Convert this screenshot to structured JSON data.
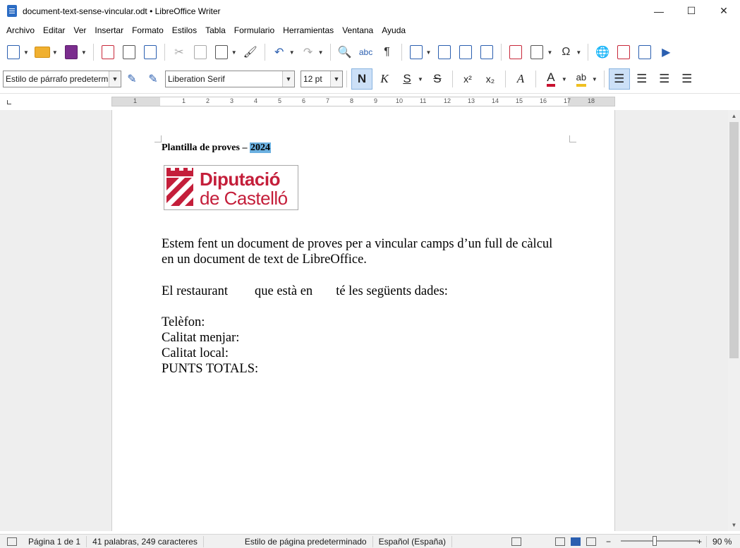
{
  "window": {
    "title": "document-text-sense-vincular.odt • LibreOffice Writer",
    "minimize": "—",
    "maximize": "☐",
    "close": "✕"
  },
  "menu": [
    "Archivo",
    "Editar",
    "Ver",
    "Insertar",
    "Formato",
    "Estilos",
    "Tabla",
    "Formulario",
    "Herramientas",
    "Ventana",
    "Ayuda"
  ],
  "formatting": {
    "paragraph_style": "Estilo de párrafo predeterminado",
    "font_name": "Liberation Serif",
    "font_size": "12 pt",
    "bold": "N",
    "italic": "K",
    "underline": "S",
    "strikethrough": "S",
    "superscript": "x²",
    "subscript": "x₂"
  },
  "ruler": {
    "labels": [
      "1",
      "1",
      "2",
      "3",
      "4",
      "5",
      "6",
      "7",
      "8",
      "9",
      "10",
      "11",
      "12",
      "13",
      "14",
      "15",
      "16",
      "17",
      "18"
    ]
  },
  "document": {
    "title_text": "Plantilla de proves – ",
    "title_year": "2024",
    "logo_line1": "Diputació",
    "logo_line2": "de Castelló",
    "para1_line1": "Estem fent un document de proves per a vincular camps d’un full de càlcul",
    "para1_line2": "en un document de text de LibreOffice.",
    "para2_a": "El restaurant",
    "para2_b": "que està en",
    "para2_c": "té les següents dades:",
    "telefon": "Telèfon:",
    "calitat_menjar": "Calitat menjar:",
    "calitat_local": "Calitat local:",
    "punts_totals": "PUNTS TOTALS:"
  },
  "status": {
    "page": "Página 1 de 1",
    "words": "41 palabras, 249 caracteres",
    "page_style": "Estilo de página predeterminado",
    "language": "Español (España)",
    "zoom": "90 %"
  },
  "colors": {
    "accent": "#2b5fb0",
    "logo_red": "#c41e3a",
    "selection": "#6bb0e0",
    "spellcheck": "#e02020"
  }
}
